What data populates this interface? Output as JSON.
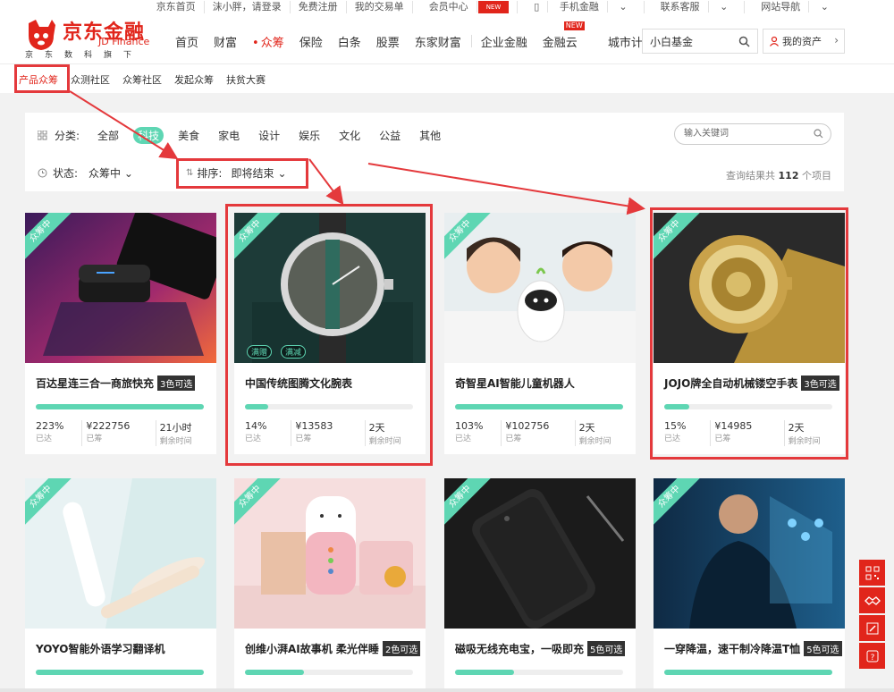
{
  "topbar": {
    "links": [
      "京东首页",
      "沫小胖，请登录",
      "免费注册",
      "我的交易单",
      "会员中心",
      "手机金融",
      "联系客服",
      "网站导航"
    ],
    "member_badge": "NEW"
  },
  "logo": {
    "cn": "京东金融",
    "en": "JD Finance",
    "sub": "京东数科旗下"
  },
  "nav": {
    "items": [
      "首页",
      "财富",
      "众筹",
      "保险",
      "白条",
      "股票",
      "东家财富",
      "企业金融",
      "金融云",
      "城市计算"
    ],
    "active_index": 2,
    "new_badge": "NEW"
  },
  "search": {
    "value": "小白基金"
  },
  "my_asset": {
    "label": "我的资产"
  },
  "subnav": {
    "items": [
      "产品众筹",
      "众测社区",
      "众筹社区",
      "发起众筹",
      "扶贫大赛"
    ],
    "active_index": 0
  },
  "filter": {
    "category_label": "分类:",
    "categories": [
      "全部",
      "科技",
      "美食",
      "家电",
      "设计",
      "娱乐",
      "文化",
      "公益",
      "其他"
    ],
    "active_category": 1,
    "keyword_placeholder": "输入关键词",
    "status_label": "状态:",
    "status_value": "众筹中",
    "sort_label": "排序:",
    "sort_value": "即将结束",
    "result_prefix": "查询结果共",
    "result_count": "112",
    "result_suffix": "个项目"
  },
  "products": [
    {
      "title": "百达星连三合一商旅快充",
      "badge": "3色可选",
      "ribbon": "众筹中",
      "progress": 1.0,
      "reached": "223%",
      "reached_label": "已达",
      "raised": "¥222756",
      "raised_label": "已筹",
      "remain": "21小时",
      "remain_label": "剩余时间"
    },
    {
      "title": "中国传统图腾文化腕表",
      "badge": "",
      "ribbon": "众筹中",
      "progress": 0.14,
      "reached": "14%",
      "reached_label": "已达",
      "raised": "¥13583",
      "raised_label": "已筹",
      "remain": "2天",
      "remain_label": "剩余时间",
      "tags": [
        "满赠",
        "满减"
      ]
    },
    {
      "title": "奇智星AI智能儿童机器人",
      "badge": "",
      "ribbon": "众筹中",
      "progress": 1.0,
      "reached": "103%",
      "reached_label": "已达",
      "raised": "¥102756",
      "raised_label": "已筹",
      "remain": "2天",
      "remain_label": "剩余时间"
    },
    {
      "title": "JOJO牌全自动机械镂空手表",
      "badge": "3色可选",
      "ribbon": "众筹中",
      "progress": 0.15,
      "reached": "15%",
      "reached_label": "已达",
      "raised": "¥14985",
      "raised_label": "已筹",
      "remain": "2天",
      "remain_label": "剩余时间"
    },
    {
      "title": "YOYO智能外语学习翻译机",
      "badge": "",
      "ribbon": "众筹中",
      "progress": 1.0
    },
    {
      "title": "创维小湃AI故事机 柔光伴睡",
      "badge": "2色可选",
      "ribbon": "众筹中",
      "progress": 0.35
    },
    {
      "title": "磁吸无线充电宝，一吸即充",
      "badge": "5色可选",
      "ribbon": "众筹中",
      "progress": 0.35
    },
    {
      "title": "一穿降温，速干制冷降温T恤",
      "badge": "5色可选",
      "ribbon": "众筹中",
      "progress": 1.0
    }
  ],
  "colors": {
    "brand": "#e1251b",
    "accent": "#5ed6b3",
    "highlight_box": "#e4393c"
  }
}
